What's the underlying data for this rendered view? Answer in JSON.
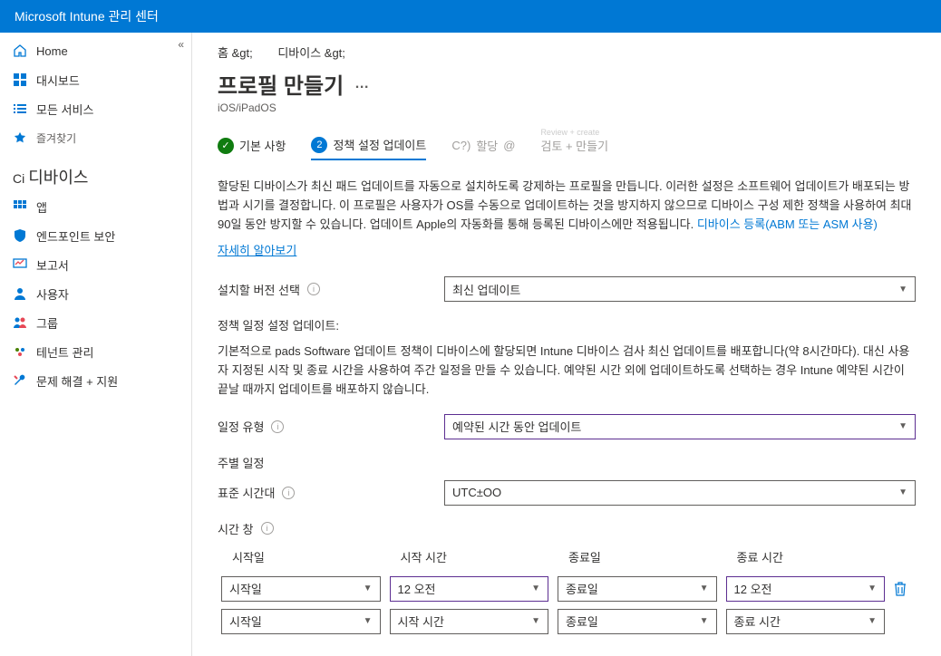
{
  "topbar": {
    "title": "Microsoft Intune 관리 센터"
  },
  "sidebar": {
    "home": "Home",
    "dashboard": "대시보드",
    "all_services": "모든 서비스",
    "favorites": "즐겨찾기",
    "devices_heading": "디바이스",
    "ci_prefix": "Ci",
    "apps": "앱",
    "endpoint_security": "엔드포인트 보안",
    "reports": "보고서",
    "users": "사용자",
    "groups": "그룹",
    "tenant_admin": "테넌트 관리",
    "troubleshoot": "문제 해결 + 지원"
  },
  "breadcrumb": {
    "home": "홈 &gt;",
    "devices": "디바이스 &gt;"
  },
  "page": {
    "title": "프로필 만들기",
    "ellipsis": "…",
    "subtitle": "iOS/iPadOS"
  },
  "wizard": {
    "step1": "기본 사항",
    "step2": "정책 설정 업데이트",
    "step3": "할당",
    "step3_prefix": "C?)",
    "step3_suffix": "@",
    "step4": "검토 + 만들기",
    "step4_alt": "Review + create"
  },
  "description": "할당된 디바이스가 최신 패드 업데이트를 자동으로 설치하도록 강제하는 프로필을 만듭니다. 이러한 설정은 소프트웨어 업데이트가 배포되는 방법과 시기를 결정합니다. 이 프로필은 사용자가 OS를 수동으로 업데이트하는 것을 방지하지 않으므로 디바이스 구성 제한 정책을 사용하여 최대 90일 동안 방지할 수 있습니다. 업데이트 Apple의 자동화를 통해 등록된 디바이스에만 적용됩니다. ",
  "desc_link": "디바이스 등록(ABM 또는 ASM 사용)",
  "learn_more": "자세히 알아보기",
  "form": {
    "version_label": "설치할 버전 선택",
    "version_value": "최신 업데이트",
    "policy_schedule_label": "정책 일정 설정 업데이트:",
    "policy_schedule_text": "기본적으로 pads Software 업데이트 정책이 디바이스에 할당되면 Intune 디바이스 검사 최신 업데이트를 배포합니다(약 8시간마다). 대신 사용자 지정된 시작 및 종료 시간을 사용하여 주간 일정을 만들 수 있습니다. 예약된 시간 외에 업데이트하도록 선택하는 경우 Intune 예약된 시간이 끝날 때까지 업데이트를 배포하지 않습니다.",
    "schedule_type_label": "일정 유형",
    "schedule_type_value": "예약된 시간 동안 업데이트",
    "weekly_label": "주별 일정",
    "timezone_label": "표준 시간대",
    "timezone_value": "UTC±OO",
    "time_window_label": "시간 창"
  },
  "table": {
    "headers": {
      "start_day": "시작일",
      "start_time": "시작 시간",
      "end_day": "종료일",
      "end_time": "종료 시간"
    },
    "rows": [
      {
        "start_day": "시작일",
        "start_time": "12 오전",
        "end_day": "종료일",
        "end_time": "12 오전",
        "deletable": true,
        "highlight": true
      },
      {
        "start_day": "시작일",
        "start_time": "시작 시간",
        "end_day": "종료일",
        "end_time": "종료 시간",
        "deletable": false,
        "highlight": false
      }
    ]
  }
}
